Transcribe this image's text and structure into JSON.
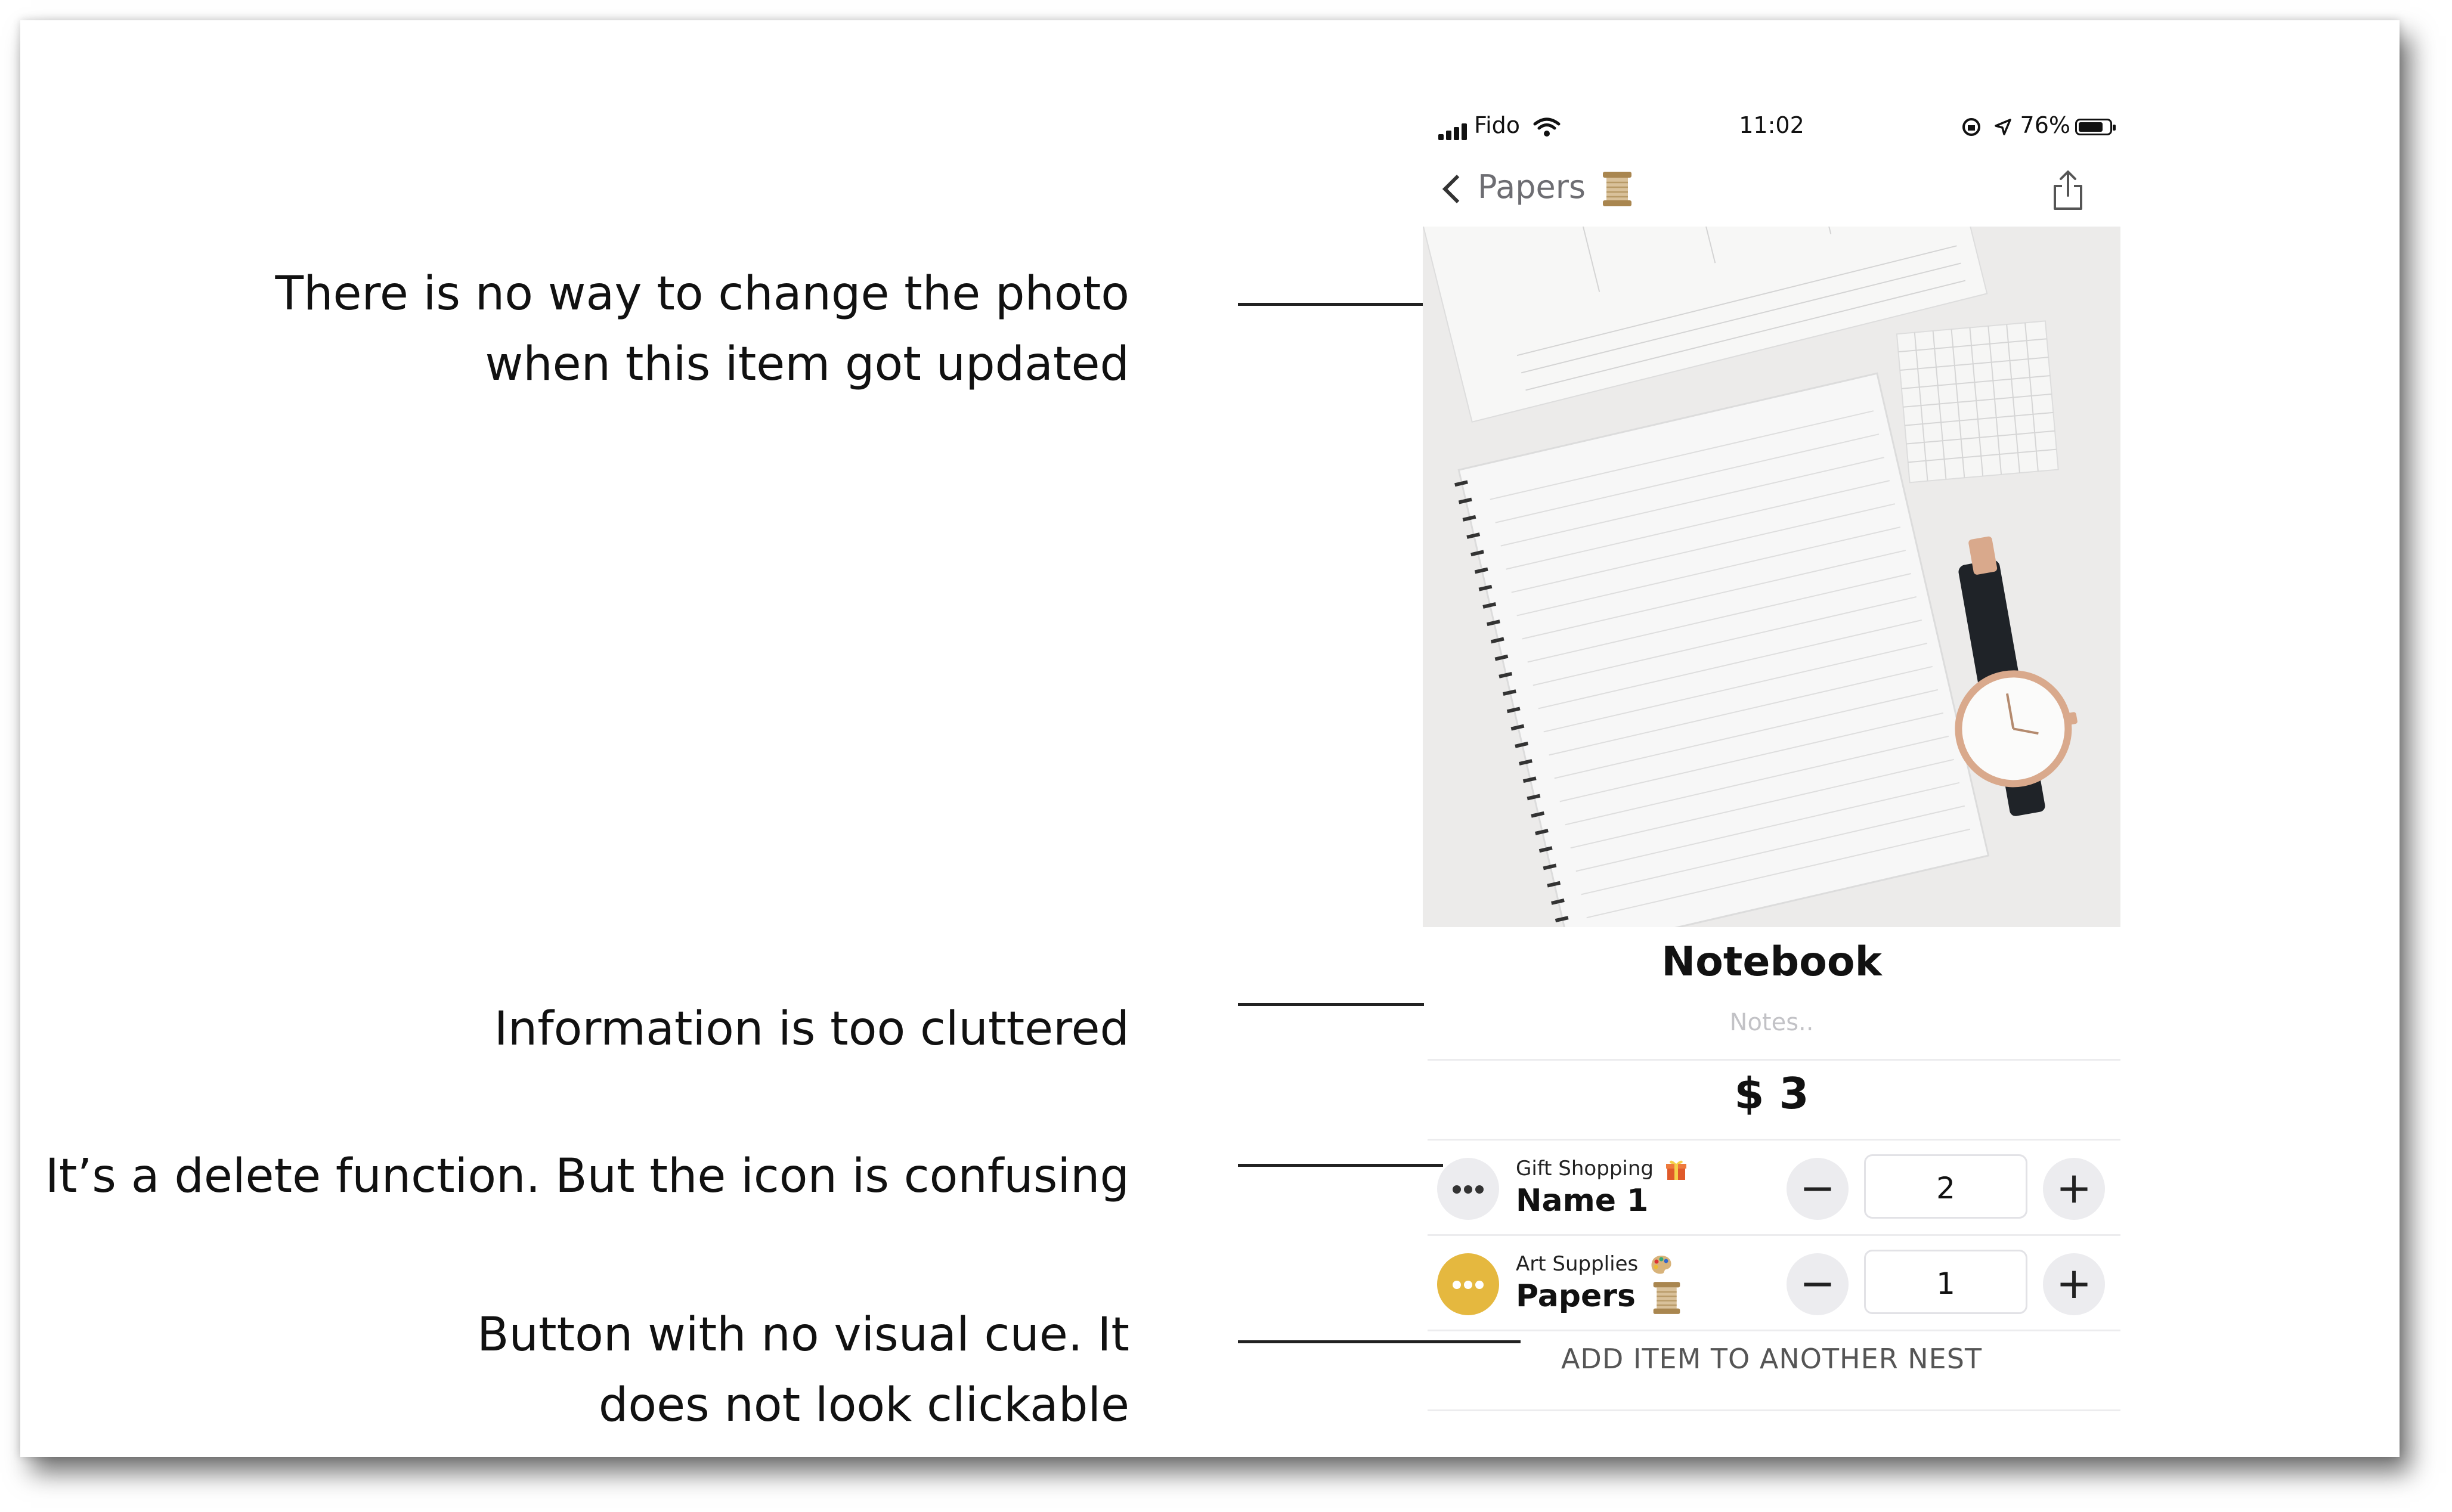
{
  "annotations": {
    "photo": [
      "There is no way to change the photo",
      "when this item got updated"
    ],
    "info": "Information is too cluttered",
    "delete": "It’s a delete function. But the icon is confusing",
    "button": [
      "Button with no visual cue. It",
      "does not look clickable"
    ]
  },
  "status_bar": {
    "carrier": "Fido",
    "time": "11:02",
    "battery": "76%"
  },
  "nav": {
    "back_label": "Papers",
    "share_icon": "share-icon"
  },
  "item": {
    "title": "Notebook",
    "notes_placeholder": "Notes..",
    "price": "$ 3"
  },
  "nests": [
    {
      "category": "Gift Shopping",
      "name": "Name 1",
      "quantity": "2",
      "dots_color": "#ececef"
    },
    {
      "category": "Art Supplies",
      "name": "Papers",
      "quantity": "1",
      "dots_color": "#e5b83f"
    }
  ],
  "controls": {
    "minus": "−",
    "plus": "+"
  },
  "add_button": "ADD ITEM TO ANOTHER NEST"
}
